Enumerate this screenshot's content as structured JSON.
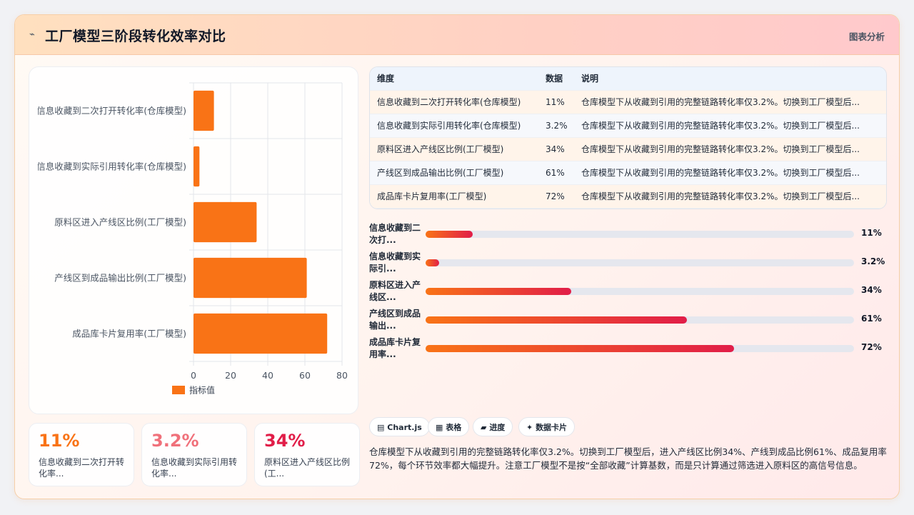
{
  "header": {
    "logo_icon": "chart-spark-icon",
    "title": "工厂模型三阶段转化效率对比",
    "action": "图表分析"
  },
  "chart_data": {
    "type": "bar",
    "orientation": "horizontal",
    "categories": [
      "信息收藏到二次打开转化率(仓库模型)",
      "信息收藏到实际引用转化率(仓库模型)",
      "原料区进入产线区比例(工厂模型)",
      "产线区到成品输出比例(工厂模型)",
      "成品库卡片复用率(工厂模型)"
    ],
    "series": [
      {
        "name": "指标值",
        "values": [
          11,
          3.2,
          34,
          61,
          72
        ]
      }
    ],
    "xlim": [
      0,
      80
    ],
    "xticks": [
      0,
      20,
      40,
      60,
      80
    ],
    "grid": true,
    "legend": "bottom",
    "color": "#f97316"
  },
  "kpis": [
    {
      "value": "11%",
      "label": "信息收藏到二次打开转化率...",
      "color": "#f97316"
    },
    {
      "value": "3.2%",
      "label": "信息收藏到实际引用转化率...",
      "color": "#f0707a"
    },
    {
      "value": "34%",
      "label": "原料区进入产线区比例(工...",
      "color": "#e11d48"
    }
  ],
  "table": {
    "headers": [
      "维度",
      "数据",
      "说明"
    ],
    "rows": [
      [
        "信息收藏到二次打开转化率(仓库模型)",
        "11%",
        "仓库模型下从收藏到引用的完整链路转化率仅3.2%。切换到工厂模型后..."
      ],
      [
        "信息收藏到实际引用转化率(仓库模型)",
        "3.2%",
        "仓库模型下从收藏到引用的完整链路转化率仅3.2%。切换到工厂模型后..."
      ],
      [
        "原料区进入产线区比例(工厂模型)",
        "34%",
        "仓库模型下从收藏到引用的完整链路转化率仅3.2%。切换到工厂模型后..."
      ],
      [
        "产线区到成品输出比例(工厂模型)",
        "61%",
        "仓库模型下从收藏到引用的完整链路转化率仅3.2%。切换到工厂模型后..."
      ],
      [
        "成品库卡片复用率(工厂模型)",
        "72%",
        "仓库模型下从收藏到引用的完整链路转化率仅3.2%。切换到工厂模型后..."
      ]
    ],
    "row_colors": [
      "#fff4ea",
      "#f6f8fc"
    ]
  },
  "progress": [
    {
      "label": "信息收藏到二次打...",
      "value": 11,
      "text": "11%"
    },
    {
      "label": "信息收藏到实际引...",
      "value": 3.2,
      "text": "3.2%"
    },
    {
      "label": "原料区进入产线区...",
      "value": 34,
      "text": "34%"
    },
    {
      "label": "产线区到成品输出...",
      "value": 61,
      "text": "61%"
    },
    {
      "label": "成品库卡片复用率...",
      "value": 72,
      "text": "72%"
    }
  ],
  "tags": [
    {
      "icon": "chart-icon",
      "glyph": "▤",
      "label": "Chart.js"
    },
    {
      "icon": "table-icon",
      "glyph": "▦",
      "label": "表格"
    },
    {
      "icon": "progress-icon",
      "glyph": "▰",
      "label": "进度"
    },
    {
      "icon": "card-icon",
      "glyph": "✦",
      "label": "数据卡片"
    }
  ],
  "note": "仓库模型下从收藏到引用的完整链路转化率仅3.2%。切换到工厂模型后，进入产线区比例34%、产线到成品比例61%、成品复用率72%，每个环节效率都大幅提升。注意工厂模型不是按“全部收藏”计算基数，而是只计算通过筛选进入原料区的高信号信息。"
}
